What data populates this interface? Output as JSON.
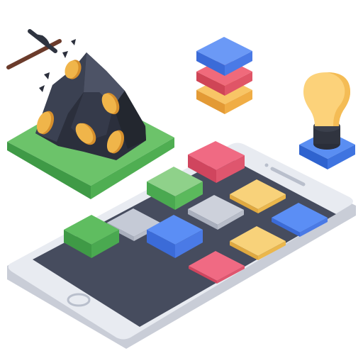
{
  "illustration": {
    "subject": "isometric-crypto-mining-app",
    "icons": [
      "pickaxe-icon",
      "coal-mountain-with-coins-icon",
      "stacked-layers-icon",
      "lightbulb-idea-icon",
      "smartphone-icon",
      "app-tile-grid"
    ]
  },
  "colors": {
    "grass_top": "#6cc36a",
    "grass_side": "#3f9a46",
    "rock_dark": "#2b2f3c",
    "rock_mid": "#3b4152",
    "rock_light": "#4d5366",
    "coin": "#f0b54a",
    "coin_shade": "#d68f2c",
    "phone_body": "#e5e8ef",
    "phone_edge": "#c9cdd7",
    "phone_screen": "#464c5e",
    "tile_pink": "#ef5a74",
    "tile_green": "#4cae55",
    "tile_blue": "#4a7ef0",
    "tile_yellow": "#f6c451",
    "tile_gray": "#c5cad6",
    "layer_blue": "#4f84f2",
    "layer_red": "#e45a6b",
    "layer_orange": "#f5b04c",
    "bulb_glass": "#fcd27a",
    "bulb_base": "#30343f",
    "bulb_stand": "#3f7ae8"
  }
}
